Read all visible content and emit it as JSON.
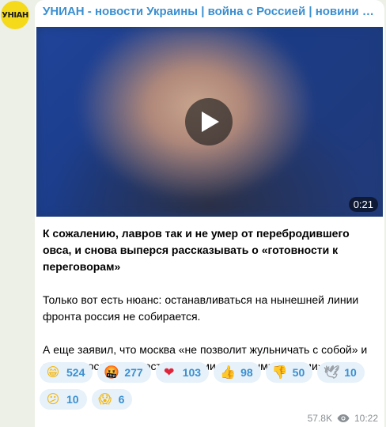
{
  "channel": {
    "title": "УНИАН - новости Украины | война с Россией | новини України...",
    "avatar_text": "УНІАН",
    "avatar_color": "#f5d91b"
  },
  "video": {
    "duration": "0:21",
    "play_icon": "play-icon"
  },
  "post": {
    "paragraph1": "К сожалению, лавров так и не умер от перебродившего овса, и снова выперся рассказывать о «готовности к переговорам»",
    "paragraph2": "Только вот есть нюанс: останавливаться на нынешней линии фронта россия не собирается.",
    "paragraph3": "А еще заявил, что москва «не позволит жульничать с собой» и назвал россиян «простодушными, наивными людьми»."
  },
  "reactions": [
    {
      "icon": "grinning-face-icon",
      "glyph": "😁",
      "count": "524",
      "color": "#f5b400"
    },
    {
      "icon": "angry-face-icon",
      "glyph": "🤬",
      "count": "277",
      "color": "#d9322a"
    },
    {
      "icon": "heart-icon",
      "glyph": "❤",
      "count": "103",
      "color": "#e0243a"
    },
    {
      "icon": "thumbs-up-icon",
      "glyph": "👍",
      "count": "98",
      "color": "#f5b400"
    },
    {
      "icon": "thumbs-down-icon",
      "glyph": "👎",
      "count": "50",
      "color": "#f5b400"
    },
    {
      "icon": "dove-icon",
      "glyph": "🕊",
      "count": "10",
      "color": "#9aa0a6"
    },
    {
      "icon": "confused-face-icon",
      "glyph": "😕",
      "count": "10",
      "color": "#f5b400"
    },
    {
      "icon": "screaming-face-icon",
      "glyph": "😱",
      "count": "6",
      "color": "#f5b400"
    }
  ],
  "meta": {
    "views": "57.8K",
    "views_icon": "eye-icon",
    "time": "10:22"
  }
}
